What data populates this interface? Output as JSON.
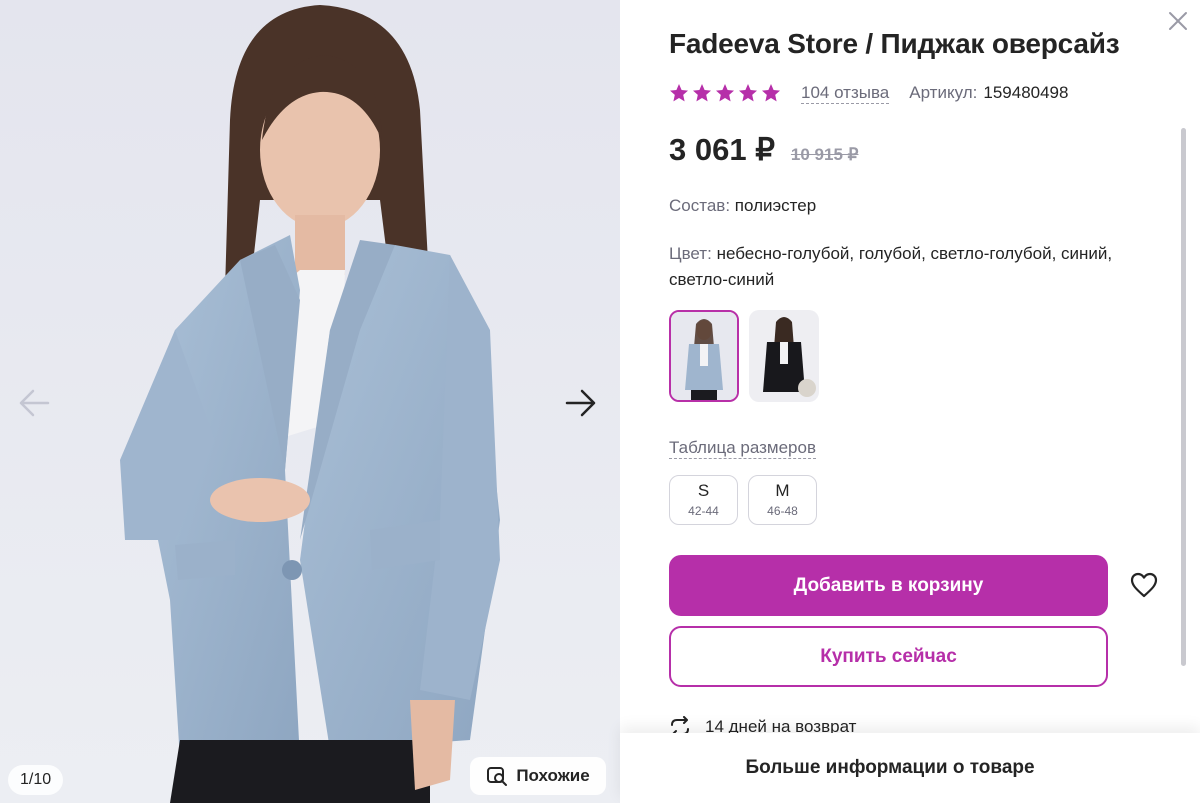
{
  "gallery": {
    "counter": "1/10",
    "similar_label": "Похожие",
    "icons": {
      "prev": "arrow-left-icon",
      "next": "arrow-right-icon",
      "similar": "image-search-icon"
    }
  },
  "product": {
    "title": "Fadeeva Store / Пиджак оверсайз",
    "rating": 5,
    "reviews_label": "104 отзыва",
    "article_label": "Артикул:",
    "article_value": "159480498",
    "price": "3 061 ₽",
    "old_price": "10 915 ₽",
    "composition_label": "Состав:",
    "composition_value": "полиэстер",
    "color_label": "Цвет:",
    "color_value": "небесно-голубой, голубой, светло-голубой, синий, светло-синий",
    "swatches": [
      {
        "name": "blue",
        "selected": true
      },
      {
        "name": "black",
        "selected": false
      }
    ],
    "size_table_label": "Таблица размеров",
    "sizes": [
      {
        "name": "S",
        "ru": "42-44"
      },
      {
        "name": "M",
        "ru": "46-48"
      }
    ],
    "add_to_cart_label": "Добавить в корзину",
    "buy_now_label": "Купить сейчас",
    "return_label": "14 дней на возврат",
    "more_info_label": "Больше информации о товаре"
  },
  "colors": {
    "accent": "#b62fa9",
    "star": "#b62fa9",
    "text": "#242424",
    "muted": "#6b6b7a"
  },
  "icons": {
    "close": "close-icon",
    "favorite": "heart-icon",
    "return": "return-arrows-icon",
    "star": "star-icon"
  }
}
